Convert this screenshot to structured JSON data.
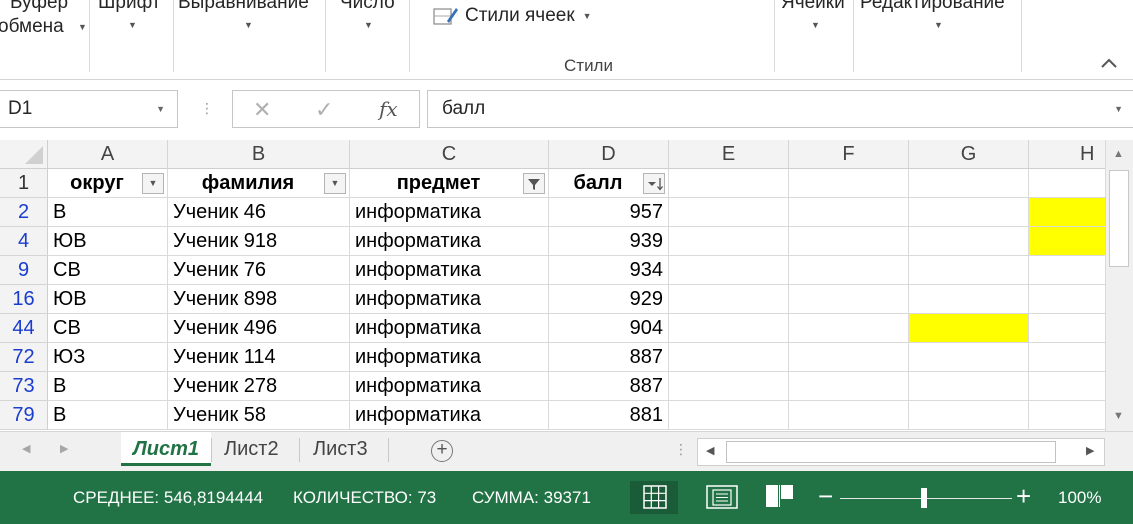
{
  "ribbon": {
    "groups": [
      {
        "label": "Буфер",
        "label2": "обмена"
      },
      {
        "label": "Шрифт"
      },
      {
        "label": "Выравнивание"
      },
      {
        "label": "Число"
      },
      {
        "label": "Ячейки"
      },
      {
        "label": "Редактирование"
      }
    ],
    "cell_styles_label": "Стили ячеек",
    "styles_group_title": "Стили"
  },
  "formula_bar": {
    "name_box": "D1",
    "cancel_glyph": "✕",
    "enter_glyph": "✓",
    "fx_glyph": "fx",
    "content": "балл"
  },
  "grid": {
    "columns": [
      "A",
      "B",
      "C",
      "D",
      "E",
      "F",
      "G",
      "H"
    ],
    "header_row_number": "1",
    "header_cells": [
      "округ",
      "фамилия",
      "предмет",
      "балл"
    ],
    "rows": [
      {
        "num": "2",
        "okrug": "В",
        "familiya": "Ученик 46",
        "predmet": "информатика",
        "ball": "957"
      },
      {
        "num": "4",
        "okrug": "ЮВ",
        "familiya": "Ученик 918",
        "predmet": "информатика",
        "ball": "939"
      },
      {
        "num": "9",
        "okrug": "СВ",
        "familiya": "Ученик 76",
        "predmet": "информатика",
        "ball": "934"
      },
      {
        "num": "16",
        "okrug": "ЮВ",
        "familiya": "Ученик 898",
        "predmet": "информатика",
        "ball": "929"
      },
      {
        "num": "44",
        "okrug": "СВ",
        "familiya": "Ученик 496",
        "predmet": "информатика",
        "ball": "904"
      },
      {
        "num": "72",
        "okrug": "ЮЗ",
        "familiya": "Ученик 114",
        "predmet": "информатика",
        "ball": "887"
      },
      {
        "num": "73",
        "okrug": "В",
        "familiya": "Ученик 278",
        "predmet": "информатика",
        "ball": "887"
      },
      {
        "num": "79",
        "okrug": "В",
        "familiya": "Ученик 58",
        "predmet": "информатика",
        "ball": "881"
      }
    ],
    "highlight_color": "#ffff00"
  },
  "sheets": {
    "tabs": [
      "Лист1",
      "Лист2",
      "Лист3"
    ],
    "active": "Лист1",
    "add_glyph": "+"
  },
  "status": {
    "average": "СРЕДНЕЕ: 546,8194444",
    "count": "КОЛИЧЕСТВО: 73",
    "sum": "СУММА: 39371",
    "zoom": "100%",
    "zoom_minus": "−",
    "zoom_plus": "+",
    "accent": "#217346"
  }
}
